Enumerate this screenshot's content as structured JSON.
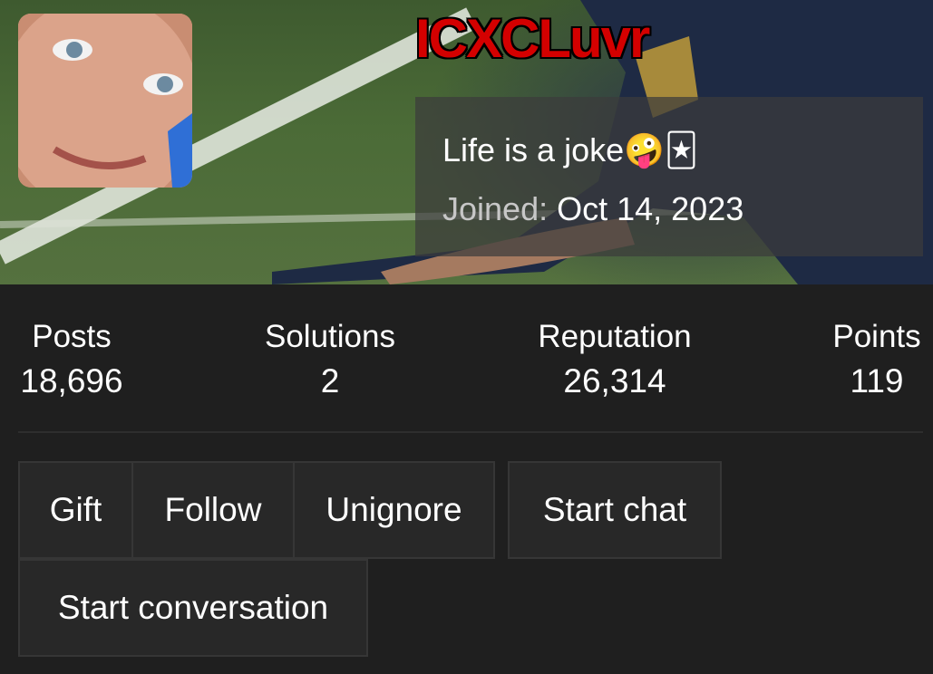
{
  "profile": {
    "username": "ICXCLuvr",
    "bio": "Life is a joke",
    "bio_emoji_1": "🤪",
    "bio_emoji_2": "🃏",
    "joined_label": "Joined:",
    "joined_value": "Oct 14, 2023"
  },
  "stats": [
    {
      "label": "Posts",
      "value": "18,696"
    },
    {
      "label": "Solutions",
      "value": "2"
    },
    {
      "label": "Reputation",
      "value": "26,314"
    },
    {
      "label": "Points",
      "value": "119"
    }
  ],
  "actions": {
    "gift": "Gift",
    "follow": "Follow",
    "unignore": "Unignore",
    "start_chat": "Start chat",
    "start_conversation": "Start conversation"
  },
  "colors": {
    "username": "#d40000",
    "background": "#1f1f1f",
    "button_bg": "#282828",
    "button_border": "#363636"
  }
}
